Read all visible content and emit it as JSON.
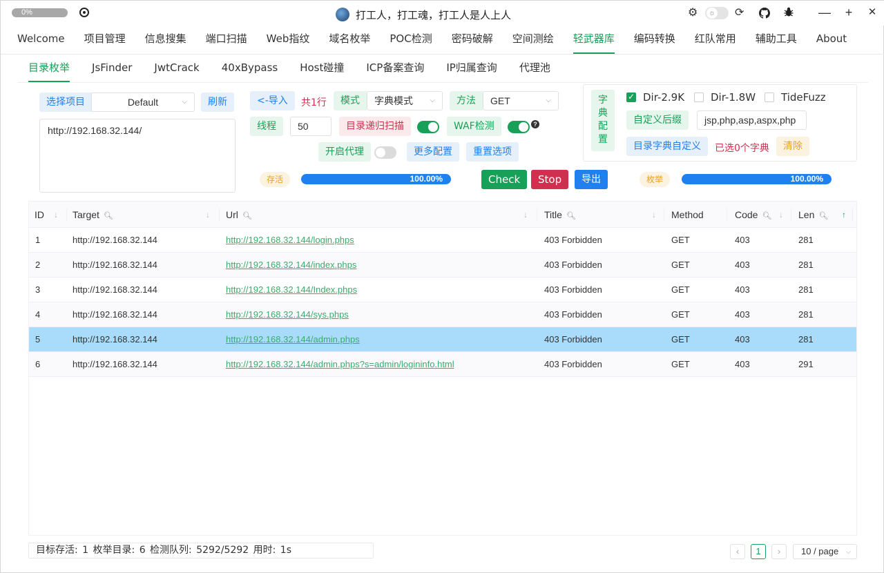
{
  "titlebar": {
    "progress_text": "0%",
    "title": "打工人，打工魂，打工人是人上人",
    "min": "—",
    "max": "+",
    "close": "✕"
  },
  "main_menu": [
    "Welcome",
    "项目管理",
    "信息搜集",
    "端口扫描",
    "Web指纹",
    "域名枚举",
    "POC检测",
    "密码破解",
    "空间测绘",
    "轻武器库",
    "编码转换",
    "红队常用",
    "辅助工具",
    "About"
  ],
  "main_menu_active": "轻武器库",
  "sub_tabs": [
    "目录枚举",
    "JsFinder",
    "JwtCrack",
    "40xBypass",
    "Host碰撞",
    "ICP备案查询",
    "IP归属查询",
    "代理池"
  ],
  "sub_tab_active": "目录枚举",
  "left": {
    "select_project_label": "选择项目",
    "project_value": "Default",
    "refresh": "刷新",
    "targets": "http://192.168.32.144/"
  },
  "config": {
    "import": "<-导入",
    "lines": "共1行",
    "mode_label": "模式",
    "mode_value": "字典模式",
    "method_label": "方法",
    "method_value": "GET",
    "threads_label": "线程",
    "threads_value": "50",
    "recursive_label": "目录递归扫描",
    "recursive_on": true,
    "waf_label": "WAF检测",
    "waf_on": true,
    "waf_help": "?",
    "proxy_label": "开启代理",
    "proxy_on": false,
    "more": "更多配置",
    "reset": "重置选项"
  },
  "dict": {
    "tag": "字典配置",
    "options": [
      {
        "label": "Dir-2.9K",
        "checked": true
      },
      {
        "label": "Dir-1.8W",
        "checked": false
      },
      {
        "label": "TideFuzz",
        "checked": false
      }
    ],
    "suffix_label": "自定义后缀",
    "suffix_value": "jsp,php,asp,aspx,php",
    "custom_dict": "目录字典自定义",
    "selected": "已选0个字典",
    "clear": "清除"
  },
  "progress": {
    "alive_label": "存活",
    "alive_percent": "100.00%",
    "alive_fraction": 1.0,
    "check": "Check",
    "stop": "Stop",
    "export": "导出",
    "enum_label": "枚举",
    "enum_percent": "100.00%",
    "enum_fraction": 1.0
  },
  "table": {
    "columns": [
      "ID",
      "Target",
      "Url",
      "Title",
      "Method",
      "Code",
      "Len"
    ],
    "rows": [
      {
        "id": "1",
        "target": "http://192.168.32.144",
        "url": "http://192.168.32.144/login.phps",
        "title": "403 Forbidden",
        "method": "GET",
        "code": "403",
        "len": "281"
      },
      {
        "id": "2",
        "target": "http://192.168.32.144",
        "url": "http://192.168.32.144/index.phps",
        "title": "403 Forbidden",
        "method": "GET",
        "code": "403",
        "len": "281"
      },
      {
        "id": "3",
        "target": "http://192.168.32.144",
        "url": "http://192.168.32.144/Index.phps",
        "title": "403 Forbidden",
        "method": "GET",
        "code": "403",
        "len": "281"
      },
      {
        "id": "4",
        "target": "http://192.168.32.144",
        "url": "http://192.168.32.144/sys.phps",
        "title": "403 Forbidden",
        "method": "GET",
        "code": "403",
        "len": "281"
      },
      {
        "id": "5",
        "target": "http://192.168.32.144",
        "url": "http://192.168.32.144/admin.phps",
        "title": "403 Forbidden",
        "method": "GET",
        "code": "403",
        "len": "281"
      },
      {
        "id": "6",
        "target": "http://192.168.32.144",
        "url": "http://192.168.32.144/admin.phps?s=admin/logininfo.html",
        "title": "403 Forbidden",
        "method": "GET",
        "code": "403",
        "len": "291"
      }
    ],
    "selected_row": 5
  },
  "footer": {
    "status": "目标存活: 1   枚举目录: 6   检测队列: 5292/5292   用时: 1s",
    "prev": "‹",
    "page": "1",
    "next": "›",
    "page_size": "10 / page"
  }
}
